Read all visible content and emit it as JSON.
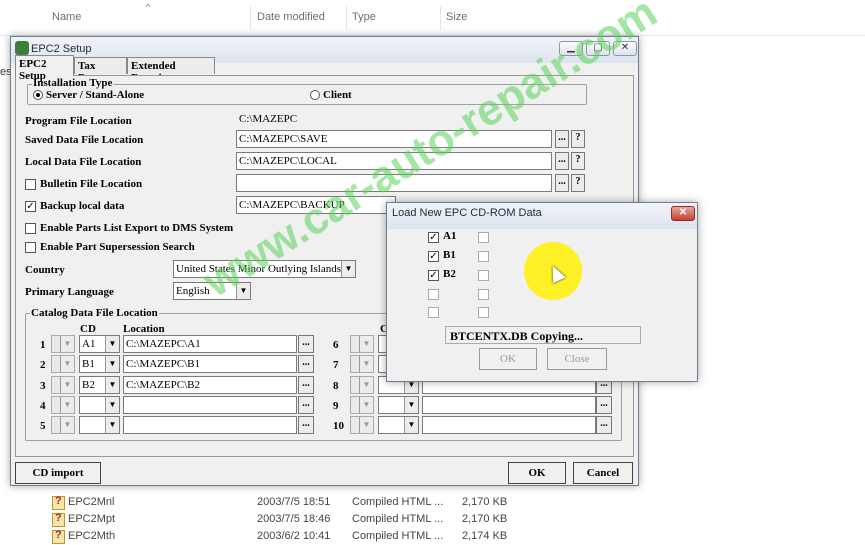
{
  "explorer": {
    "columns": [
      "Name",
      "Date modified",
      "Type",
      "Size"
    ],
    "rows": [
      {
        "name": "EPC2Mnl",
        "date": "2003/7/5 18:51",
        "type": "Compiled HTML ...",
        "size": "2,170 KB"
      },
      {
        "name": "EPC2Mpt",
        "date": "2003/7/5 18:46",
        "type": "Compiled HTML ...",
        "size": "2,170 KB"
      },
      {
        "name": "EPC2Mth",
        "date": "2003/6/2 10:41",
        "type": "Compiled HTML ...",
        "size": "2,174 KB"
      }
    ],
    "left_fragment": "es"
  },
  "setup": {
    "title": "EPC2 Setup",
    "tabs": [
      "EPC2 Setup",
      "Tax Rates",
      "Extended Function"
    ],
    "install_type": {
      "legend": "Installation Type",
      "server": "Server / Stand-Alone",
      "client": "Client"
    },
    "program_label": "Program File Location",
    "program_value": "C:\\MAZEPC",
    "saved_label": "Saved Data File Location",
    "saved_value": "C:\\MAZEPC\\SAVE",
    "local_label": "Local Data File Location",
    "local_value": "C:\\MAZEPC\\LOCAL",
    "bulletin_label": "Bulletin File Location",
    "bulletin_value": "",
    "backup_label": "Backup local data",
    "backup_value": "C:\\MAZEPC\\BACKUP",
    "dms_label": "Enable Parts List Export to DMS System",
    "supersession_label": "Enable Part Supersession Search",
    "country_label": "Country",
    "country_value": "United States Minor Outlying Islands",
    "language_label": "Primary Language",
    "language_value": "English",
    "catalog": {
      "legend": "Catalog Data File Location",
      "cd_header": "CD",
      "location_header": "Location",
      "left_rows": [
        {
          "num": "1",
          "cd": "A1",
          "loc": "C:\\MAZEPC\\A1"
        },
        {
          "num": "2",
          "cd": "B1",
          "loc": "C:\\MAZEPC\\B1"
        },
        {
          "num": "3",
          "cd": "B2",
          "loc": "C:\\MAZEPC\\B2"
        },
        {
          "num": "4",
          "cd": "",
          "loc": ""
        },
        {
          "num": "5",
          "cd": "",
          "loc": ""
        }
      ],
      "right_rows": [
        {
          "num": "6"
        },
        {
          "num": "7"
        },
        {
          "num": "8"
        },
        {
          "num": "9"
        },
        {
          "num": "10"
        }
      ],
      "right_cd_header": "C"
    },
    "browse": "...",
    "help": "?",
    "cd_import": "CD import",
    "ok": "OK",
    "cancel": "Cancel"
  },
  "load": {
    "title": "Load New EPC CD-ROM Data",
    "items": [
      "A1",
      "B1",
      "B2"
    ],
    "status": "BTCENTX.DB Copying...",
    "ok": "OK",
    "close": "Close"
  },
  "watermark": "www.car-auto-repair.com",
  "colors": {
    "watermark": "#5ad25a",
    "close_button": "#c4412f",
    "cursor_halo": "#fff000"
  }
}
